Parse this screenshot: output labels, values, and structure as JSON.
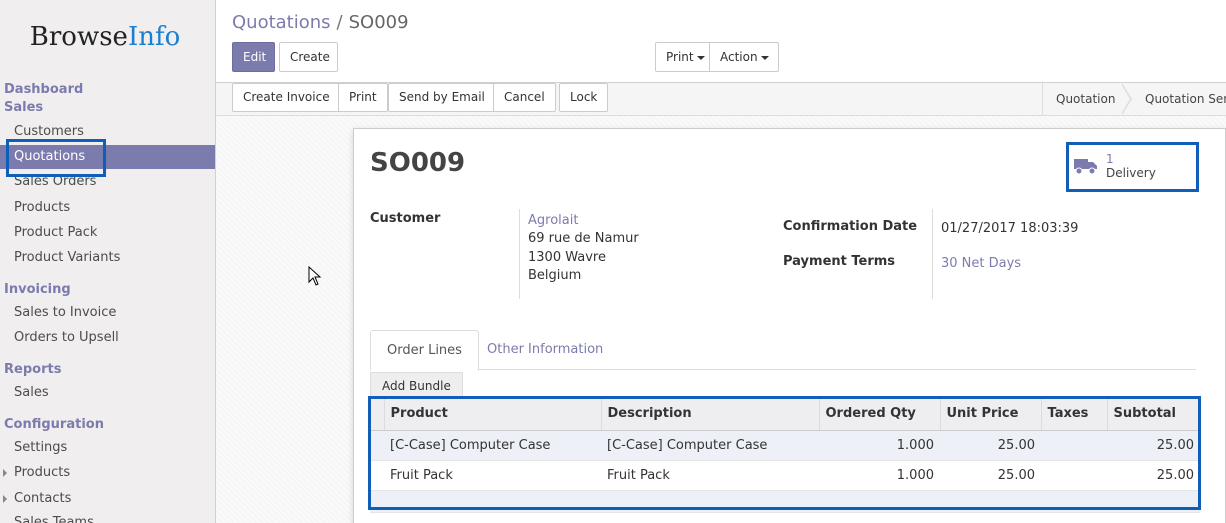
{
  "brand": {
    "part1": "Browse",
    "part2": "Info"
  },
  "sidebar": {
    "sections": {
      "dashboard": "Dashboard",
      "sales": "Sales",
      "invoicing": "Invoicing",
      "reports": "Reports",
      "configuration": "Configuration"
    },
    "sales_items": [
      "Customers",
      "Quotations",
      "Sales Orders",
      "Products",
      "Product Pack",
      "Product Variants"
    ],
    "invoicing_items": [
      "Sales to Invoice",
      "Orders to Upsell"
    ],
    "reports_items": [
      "Sales"
    ],
    "config_items": [
      "Settings",
      "Products",
      "Contacts",
      "Sales Teams"
    ]
  },
  "breadcrumb": {
    "parent": "Quotations",
    "sep": "/",
    "current": "SO009"
  },
  "toolbar": {
    "edit": "Edit",
    "create": "Create",
    "print": "Print",
    "action": "Action"
  },
  "statusbar": {
    "buttons": [
      "Create Invoice",
      "Print",
      "Send by Email",
      "Cancel",
      "Lock"
    ],
    "stages": [
      "Quotation",
      "Quotation Sent"
    ]
  },
  "form": {
    "title": "SO009",
    "smart_button": {
      "count": "1",
      "label": "Delivery"
    },
    "customer_label": "Customer",
    "customer_name": "Agrolait",
    "address": [
      "69 rue de Namur",
      "1300 Wavre",
      "Belgium"
    ],
    "confirmation_label": "Confirmation Date",
    "confirmation_value": "01/27/2017 18:03:39",
    "terms_label": "Payment Terms",
    "terms_value": "30 Net Days"
  },
  "tabs": {
    "order_lines": "Order Lines",
    "other_info": "Other Information"
  },
  "add_bundle": "Add Bundle",
  "order_lines": {
    "columns": [
      "Product",
      "Description",
      "Ordered Qty",
      "Unit Price",
      "Taxes",
      "Subtotal"
    ],
    "rows": [
      {
        "product": "[C-Case] Computer Case",
        "description": "[C-Case] Computer Case",
        "qty": "1.000",
        "price": "25.00",
        "taxes": "",
        "subtotal": "25.00"
      },
      {
        "product": "Fruit Pack",
        "description": "Fruit Pack",
        "qty": "1.000",
        "price": "25.00",
        "taxes": "",
        "subtotal": "25.00"
      }
    ]
  },
  "colors": {
    "accent": "#7c7bad",
    "highlight": "#0f5fb8",
    "brand_blue": "#1b7fd0"
  }
}
